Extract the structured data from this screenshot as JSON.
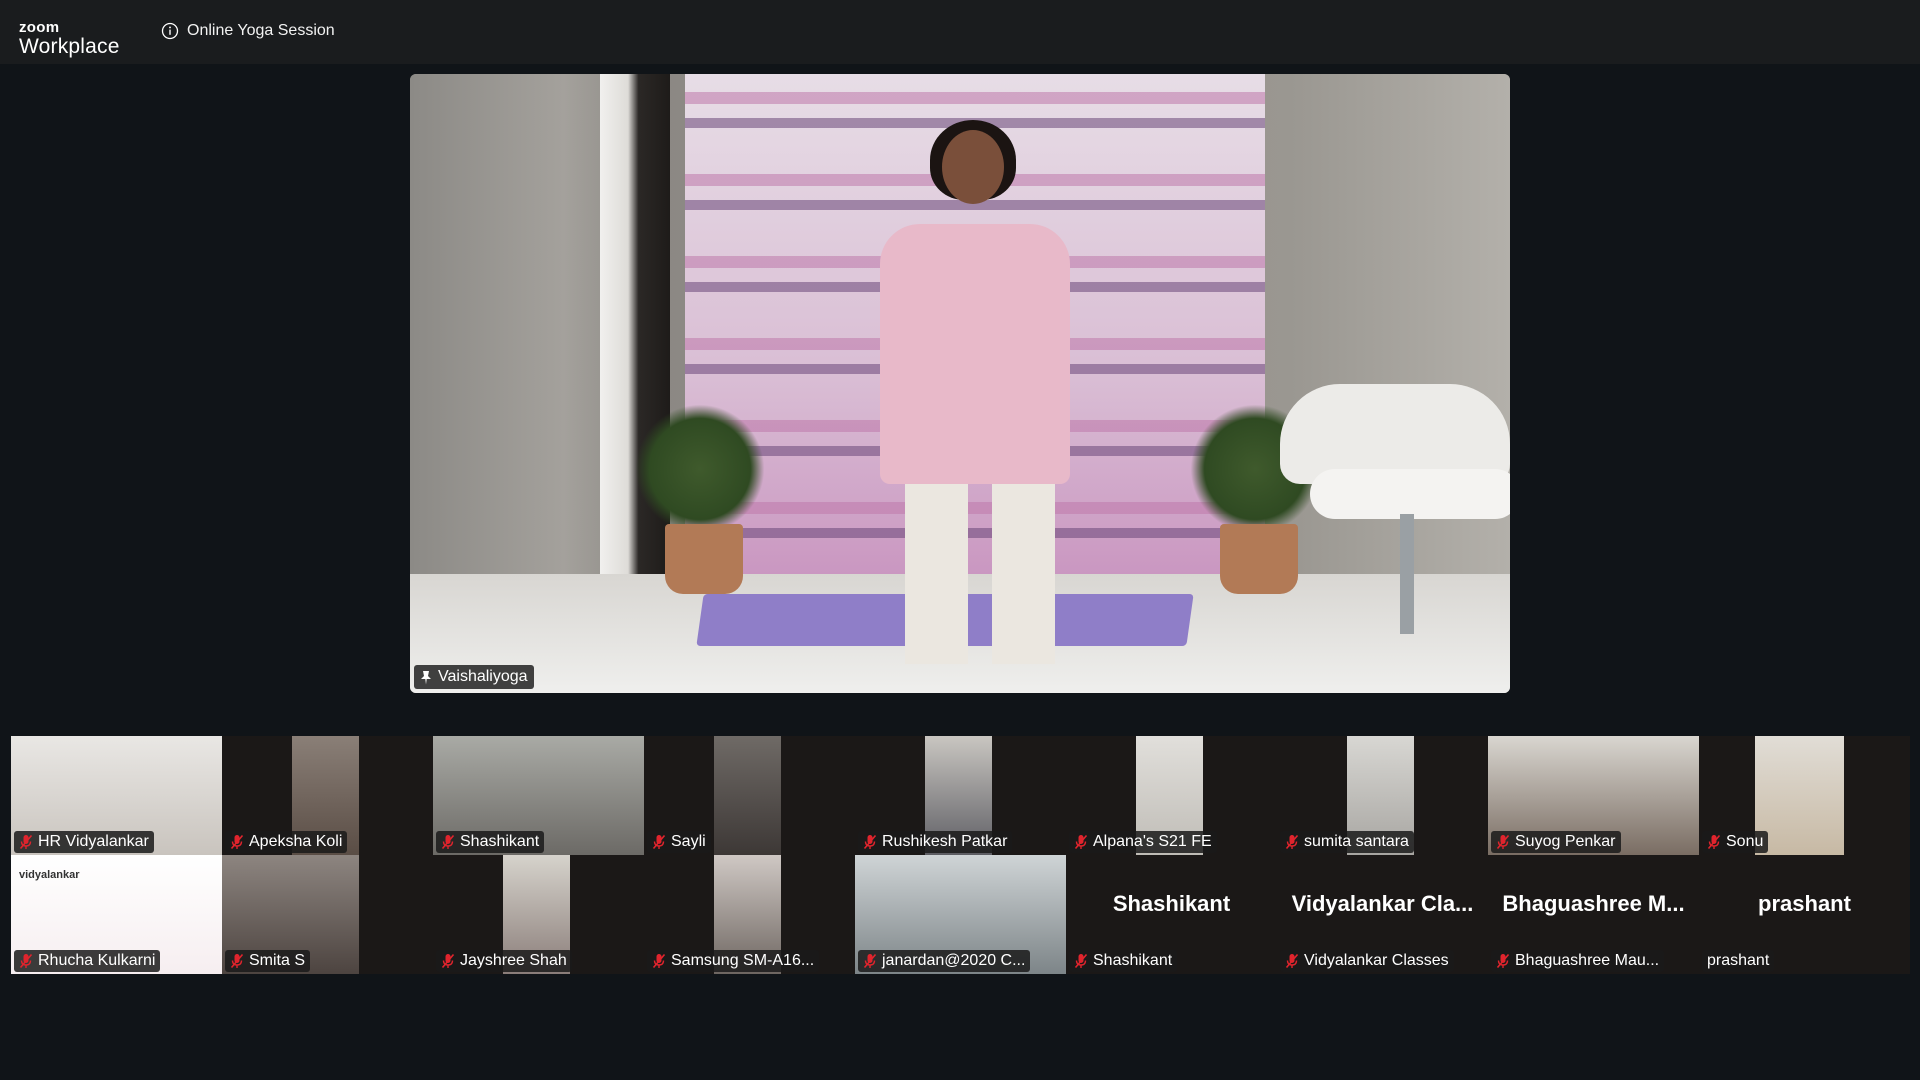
{
  "app": {
    "logo_small": "zoom",
    "logo_big": "Workplace",
    "meeting_title": "Online Yoga Session",
    "info_icon": "info-circle-icon"
  },
  "main_video": {
    "name": "Vaishaliyoga",
    "pinned": true,
    "pin_icon": "pin-icon"
  },
  "participants": [
    {
      "name": "HR Vidyalankar",
      "muted": true,
      "video": true
    },
    {
      "name": "Apeksha Koli",
      "muted": true,
      "video": true
    },
    {
      "name": "Shashikant",
      "muted": true,
      "video": true
    },
    {
      "name": "Sayli",
      "muted": true,
      "video": true
    },
    {
      "name": "Rushikesh Patkar",
      "muted": true,
      "video": true
    },
    {
      "name": "Alpana's S21 FE",
      "muted": true,
      "video": true
    },
    {
      "name": "sumita santara",
      "muted": true,
      "video": true
    },
    {
      "name": "Suyog Penkar",
      "muted": true,
      "video": true
    },
    {
      "name": "Sonu",
      "muted": true,
      "video": true
    },
    {
      "name": "Rhucha Kulkarni",
      "muted": true,
      "video": true,
      "logo_text": "vidyalankar"
    },
    {
      "name": "Smita S",
      "muted": true,
      "video": true
    },
    {
      "name": "Jayshree Shah",
      "muted": true,
      "video": true
    },
    {
      "name": "Samsung SM-A16...",
      "muted": true,
      "video": true
    },
    {
      "name": "janardan@2020 C...",
      "muted": true,
      "video": true
    },
    {
      "name": "Shashikant",
      "muted": true,
      "video": false,
      "display_name": "Shashikant"
    },
    {
      "name": "Vidyalankar Classes",
      "muted": true,
      "video": false,
      "display_name": "Vidyalankar  Cla..."
    },
    {
      "name": "Bhaguashree Mau...",
      "muted": true,
      "video": false,
      "display_name": "Bhaguashree  M..."
    },
    {
      "name": "prashant",
      "muted": false,
      "video": false,
      "display_name": "prashant"
    }
  ],
  "colors": {
    "background": "#101418",
    "topbar": "#1a1c1e",
    "mute_red": "#e0242d",
    "tile_dark": "#1b1817"
  }
}
